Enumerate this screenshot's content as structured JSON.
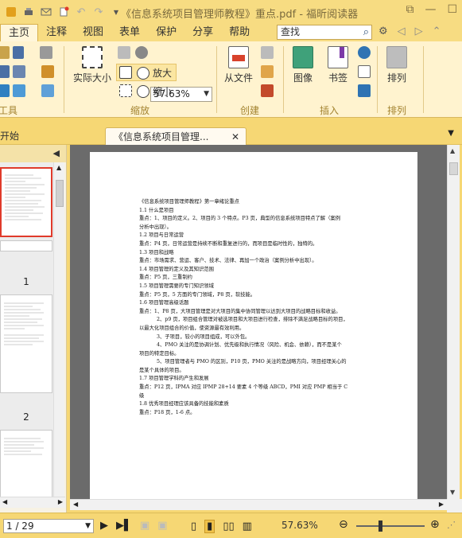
{
  "window": {
    "title": "《信息系统项目管理师教程》重点.pdf - 福昕阅读器",
    "quick_access": [
      "print-icon",
      "mail-icon",
      "new-icon",
      "undo-icon",
      "redo-icon"
    ],
    "controls": [
      "restore-icon",
      "minimize-icon",
      "maximize-icon",
      "close-icon"
    ]
  },
  "menu": {
    "items": [
      "主页",
      "注释",
      "视图",
      "表单",
      "保护",
      "分享",
      "帮助"
    ],
    "search_value": "查找"
  },
  "ribbon": {
    "zoom_value": "57.63%",
    "actual_size": "实际大小",
    "fit_page": "放大",
    "zoom_out": "缩小",
    "from_file": "从文件",
    "image": "图像",
    "bookmark": "书签",
    "arrange": "排列",
    "groups": {
      "tools": "工具",
      "zoom": "缩放",
      "create": "创建",
      "insert": "插入",
      "arrange": "排列"
    }
  },
  "tabs": {
    "start": "开始",
    "doc": "《信息系统项目管理..."
  },
  "sidebar": {
    "page1": "1",
    "page2": "2"
  },
  "document": {
    "lines": [
      "《信息系统项目管理师教程》第一章绪论重点",
      "1.1  什么是项目",
      "重点：1、项目的定义。2、项目的 3 个特点。P3 页，典型的信息系统项目特点了解（案例",
      "分析中出现）。",
      "1.2  项目与日常运营",
      "重点：P4 页，日常运营是持续不断和重复进行的，而项目是临时性的，独特的。",
      "1.3  项目和战略",
      "重点：市场需求、营运、客户、技术、法律、再加一个政治（案例分析中出现）。",
      "1.4  项目管理的定义及其知识范围",
      "重点：P5 页，三重制约",
      "1.5  项目管理需要的专门知识领域",
      "重点：P5 页，5 方面的专门领域，P8 页，软技能。",
      "1.6  项目管理高级话题",
      "重点：1、P8 页，大项目管理是对大项目的集中协同管理以达到大项目的战略目标和收益。",
      "2、p9 页，项目组合管理对被选项目和大项目进行检查，排除不满足战略目标的项目，",
      "以最大化项目组合的价值，使资源最有效利用。",
      "3、子项目，较小的项目组成，可以外包。",
      "4、PMO 关注的是协调计划、优先级和执行情况（风险、机会、依赖），而不是某个",
      "项目的特定目标。",
      "5、项目管理者与 PMO 的区别，P10 页，PMO 关注的是战略方向，项目经理关心的",
      "是某个具体的项目。",
      "1.7  项目管理学科的产生和发展",
      "重点：P12 页，IPMA 对应 IPMP 28+14 要素 4 个等级 ABCD，PMI 对应 PMP   相当于 C",
      "级",
      "1.8  优秀项目经理应该具备的技能和素质",
      "重点：P18 页，1-6 点。"
    ]
  },
  "status": {
    "page_value": "1 / 29",
    "zoom": "57.63%"
  }
}
